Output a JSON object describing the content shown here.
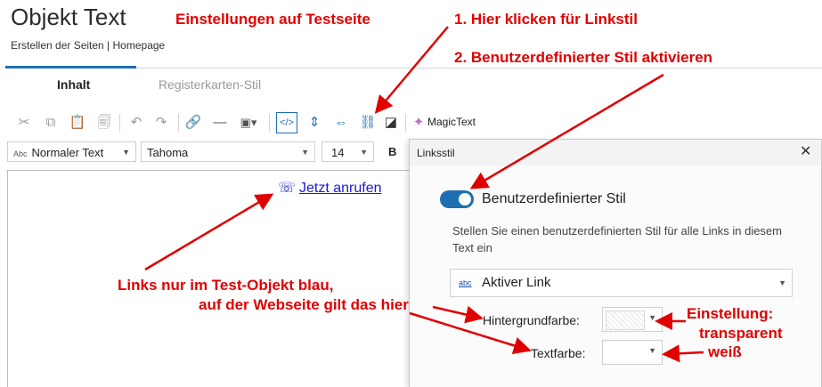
{
  "header": {
    "title": "Objekt Text",
    "breadcrumb": "Erstellen der Seiten | Homepage"
  },
  "tabs": [
    {
      "label": "Inhalt",
      "active": true
    },
    {
      "label": "Registerkarten-Stil",
      "active": false
    }
  ],
  "toolbar": {
    "icons": [
      "cut-icon",
      "copy-icon",
      "paste-icon",
      "paste-text-icon",
      "undo-icon",
      "redo-icon",
      "link-icon",
      "horizontal-rule-icon",
      "image-icon",
      "html-source-icon",
      "height-icon",
      "width-icon",
      "link-style-icon",
      "contrast-icon",
      "magic-icon"
    ],
    "magic_label": "MagicText",
    "paragraph_style": "Normaler Text",
    "font": "Tahoma",
    "font_size": "14",
    "bold": "B"
  },
  "editor": {
    "phone_icon": "☏",
    "link_text": "Jetzt anrufen"
  },
  "dialog": {
    "title": "Linksstil",
    "close": "✕",
    "toggle_label": "Benutzerdefinierter Stil",
    "toggle_on": true,
    "description": "Stellen Sie einen benutzerdefinierten Stil für alle Links in diesem Text ein",
    "link_state_icon": "abc",
    "link_state": "Aktiver Link",
    "background_label": "Hintergrundfarbe:",
    "text_color_label": "Textfarbe:"
  },
  "annotations": {
    "settings": "Einstellungen auf Testseite",
    "step1": "1. Hier klicken für Linkstil",
    "step2": "2. Benutzerdefinierter Stil aktivieren",
    "links_line1": "Links nur im Test-Objekt blau,",
    "links_line2": "auf der Webseite gilt das hier",
    "setting_line1": "Einstellung:",
    "setting_line2": "transparent",
    "setting_line3": "weiß"
  },
  "colors": {
    "accent": "#1f6fb0",
    "annotation": "#e10000",
    "link": "#1a1ad6"
  }
}
